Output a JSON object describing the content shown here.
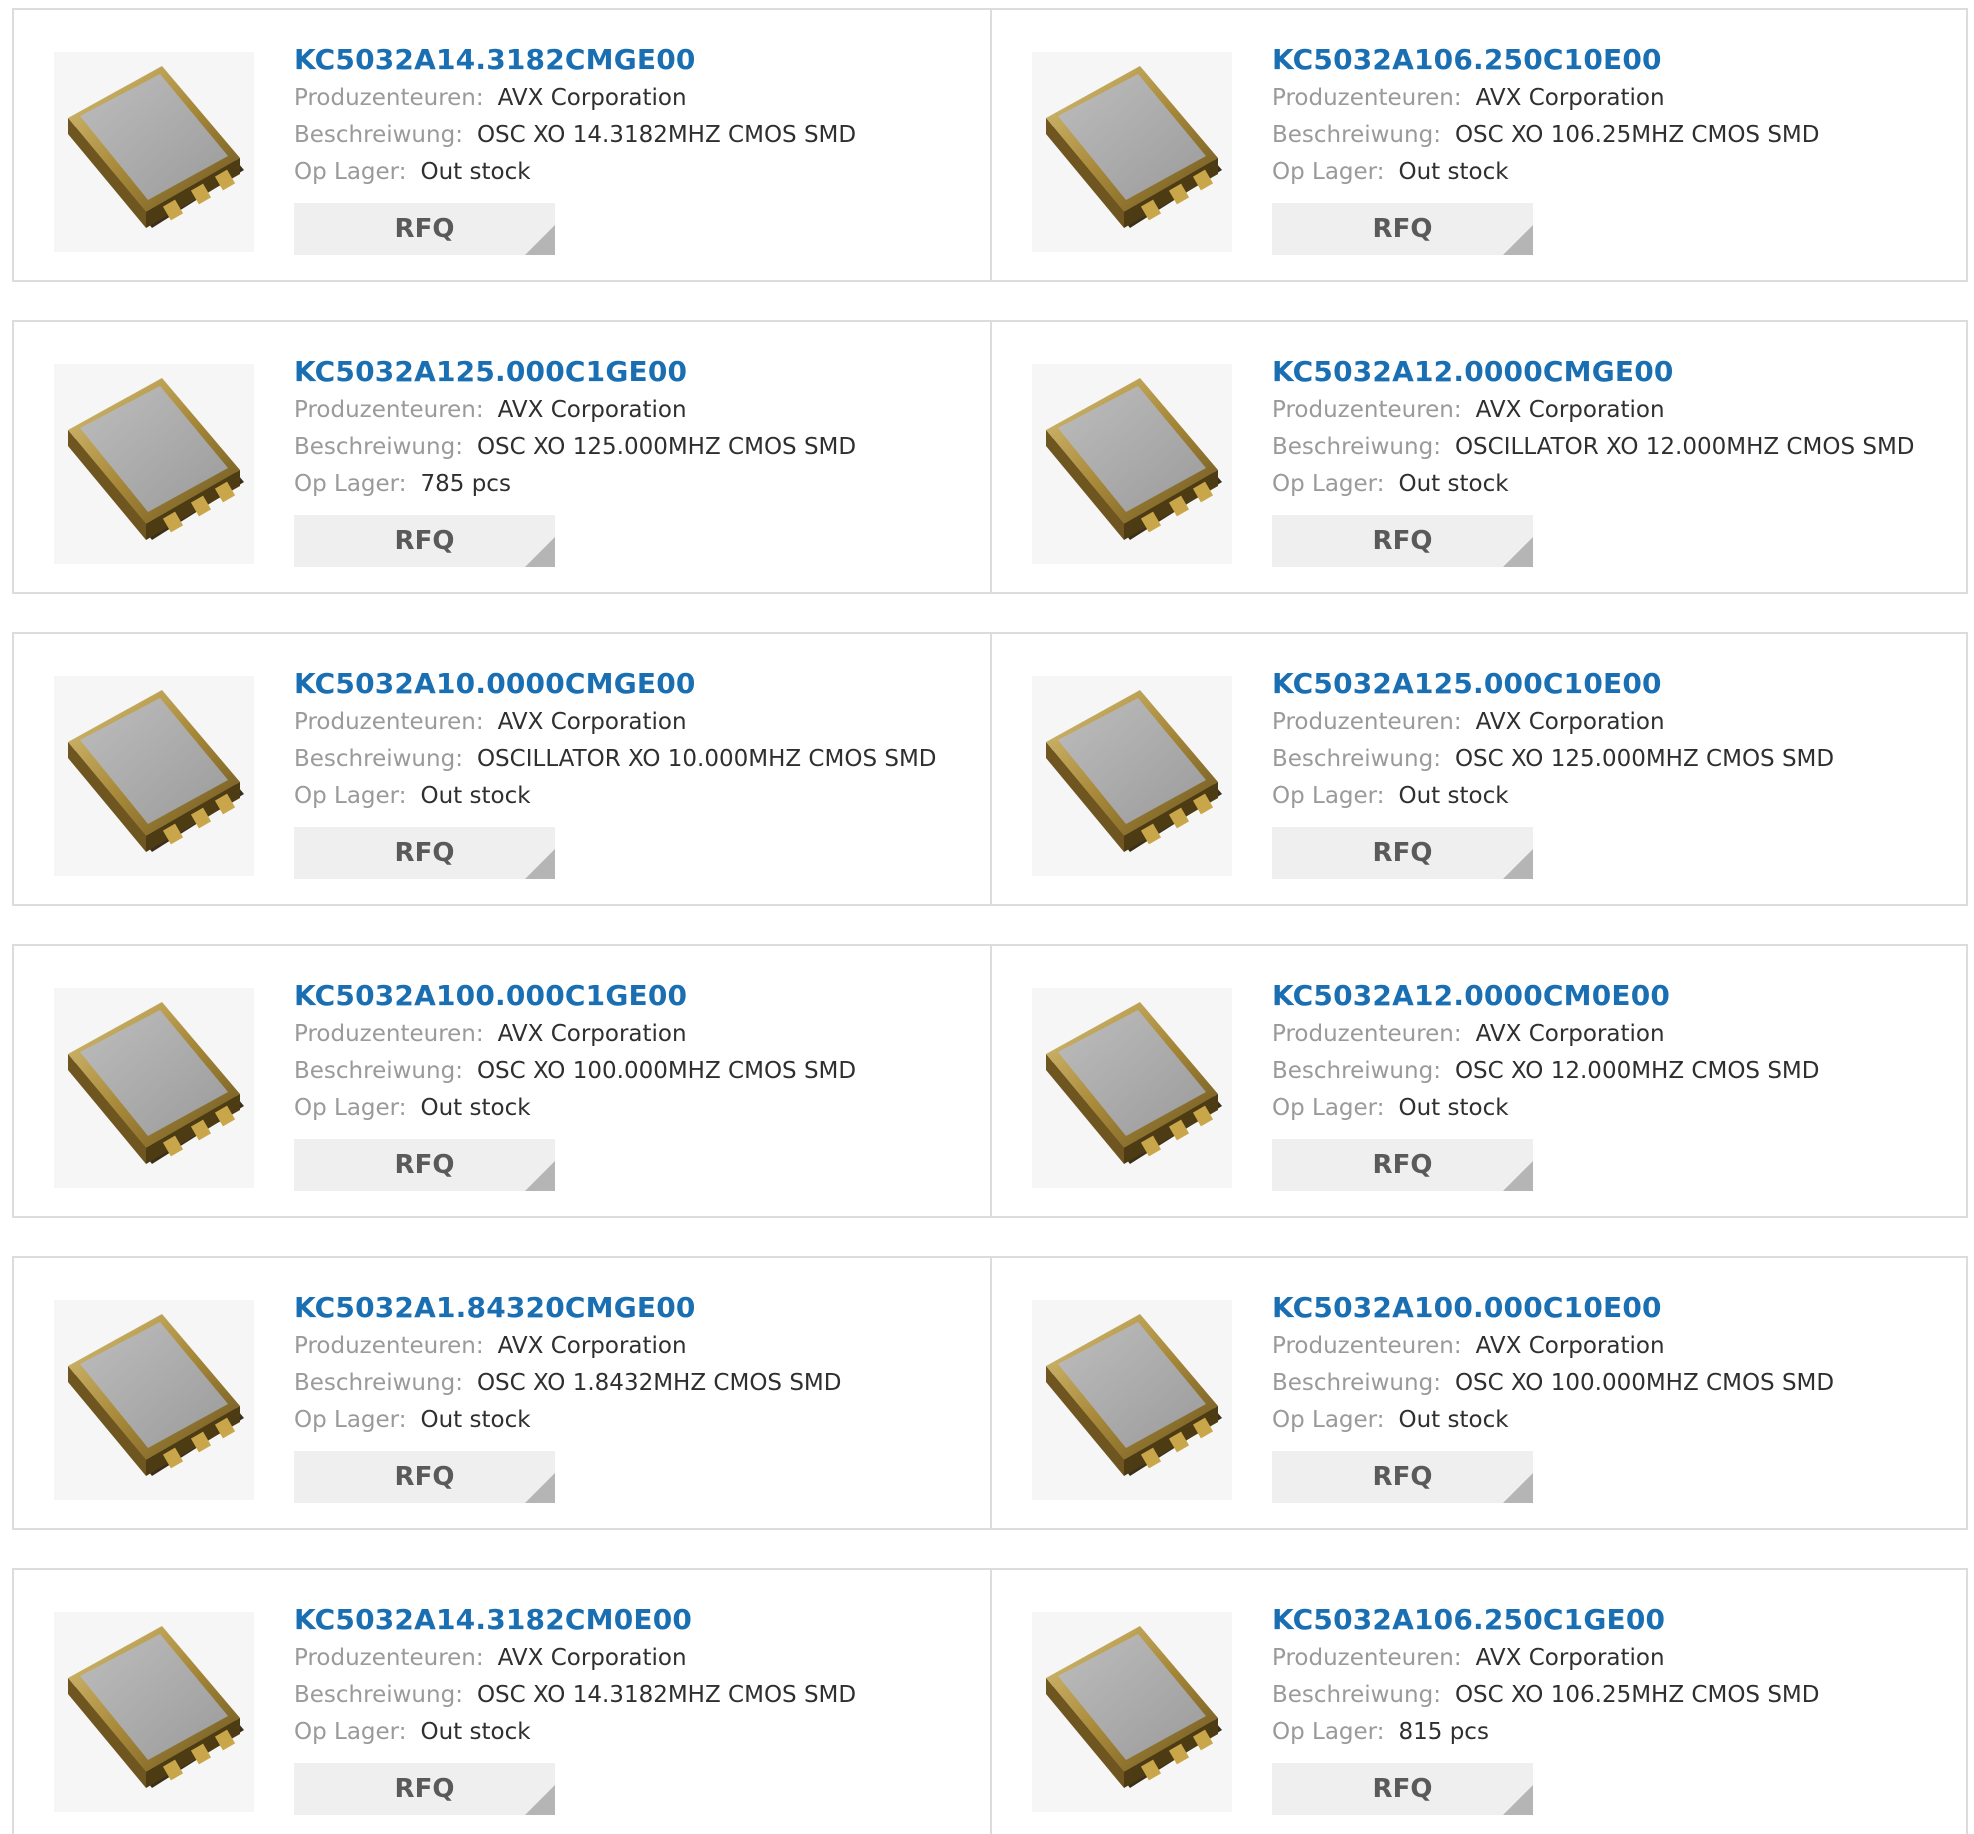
{
  "labels": {
    "manufacturer": "Produzenteuren:",
    "description": "Beschreiwung:",
    "stock": "Op Lager:",
    "rfq": "RFQ"
  },
  "colors": {
    "title": "#1a6fb3",
    "border": "#dcdcdc",
    "button_bg": "#efefef",
    "button_corner": "#b5b5b5"
  },
  "products": [
    {
      "part": "KC5032A14.3182CMGE00",
      "manufacturer": "AVX Corporation",
      "description": "OSC XO 14.3182MHZ CMOS SMD",
      "stock": "Out stock",
      "icon": "crystal-oscillator-image"
    },
    {
      "part": "KC5032A106.250C10E00",
      "manufacturer": "AVX Corporation",
      "description": "OSC XO 106.25MHZ CMOS SMD",
      "stock": "Out stock",
      "icon": "crystal-oscillator-image"
    },
    {
      "part": "KC5032A125.000C1GE00",
      "manufacturer": "AVX Corporation",
      "description": "OSC XO 125.000MHZ CMOS SMD",
      "stock": "785 pcs",
      "icon": "crystal-oscillator-image"
    },
    {
      "part": "KC5032A12.0000CMGE00",
      "manufacturer": "AVX Corporation",
      "description": "OSCILLATOR XO 12.000MHZ CMOS SMD",
      "stock": "Out stock",
      "icon": "crystal-oscillator-image"
    },
    {
      "part": "KC5032A10.0000CMGE00",
      "manufacturer": "AVX Corporation",
      "description": "OSCILLATOR XO 10.000MHZ CMOS SMD",
      "stock": "Out stock",
      "icon": "crystal-oscillator-image"
    },
    {
      "part": "KC5032A125.000C10E00",
      "manufacturer": "AVX Corporation",
      "description": "OSC XO 125.000MHZ CMOS SMD",
      "stock": "Out stock",
      "icon": "crystal-oscillator-image"
    },
    {
      "part": "KC5032A100.000C1GE00",
      "manufacturer": "AVX Corporation",
      "description": "OSC XO 100.000MHZ CMOS SMD",
      "stock": "Out stock",
      "icon": "crystal-oscillator-image"
    },
    {
      "part": "KC5032A12.0000CM0E00",
      "manufacturer": "AVX Corporation",
      "description": "OSC XO 12.000MHZ CMOS SMD",
      "stock": "Out stock",
      "icon": "crystal-oscillator-image"
    },
    {
      "part": "KC5032A1.84320CMGE00",
      "manufacturer": "AVX Corporation",
      "description": "OSC XO 1.8432MHZ CMOS SMD",
      "stock": "Out stock",
      "icon": "crystal-oscillator-image"
    },
    {
      "part": "KC5032A100.000C10E00",
      "manufacturer": "AVX Corporation",
      "description": "OSC XO 100.000MHZ CMOS SMD",
      "stock": "Out stock",
      "icon": "crystal-oscillator-image"
    },
    {
      "part": "KC5032A14.3182CM0E00",
      "manufacturer": "AVX Corporation",
      "description": "OSC XO 14.3182MHZ CMOS SMD",
      "stock": "Out stock",
      "icon": "crystal-oscillator-image"
    },
    {
      "part": "KC5032A106.250C1GE00",
      "manufacturer": "AVX Corporation",
      "description": "OSC XO 106.25MHZ CMOS SMD",
      "stock": "815 pcs",
      "icon": "crystal-oscillator-image"
    }
  ]
}
